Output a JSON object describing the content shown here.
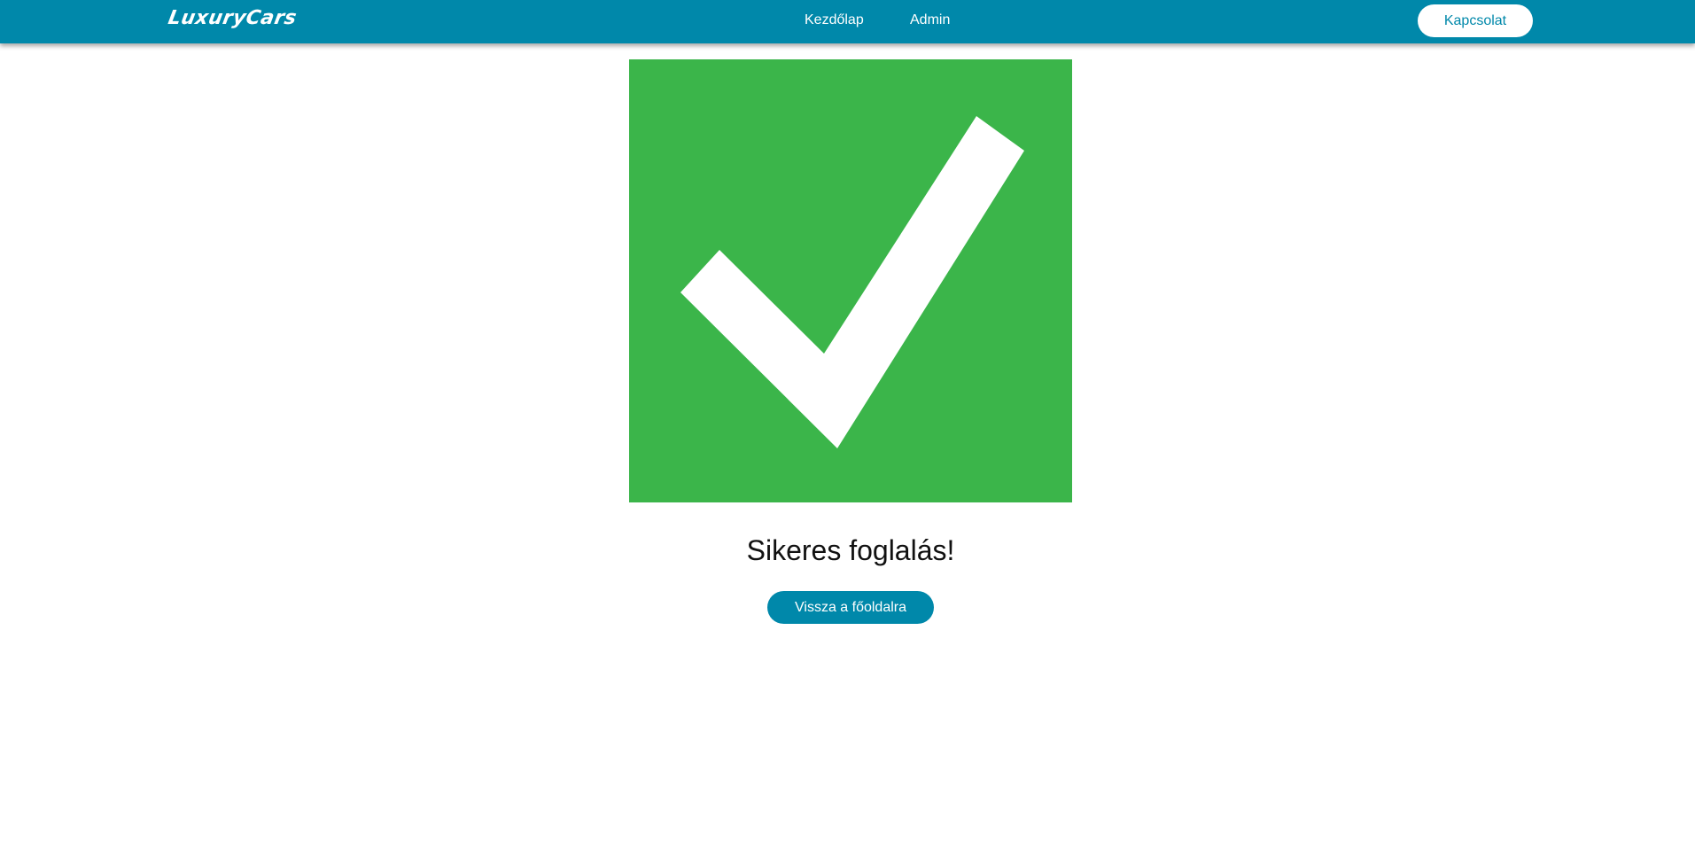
{
  "header": {
    "brand": "LuxuryCars",
    "nav": {
      "home": "Kezdőlap",
      "admin": "Admin"
    },
    "contact_label": "Kapcsolat"
  },
  "main": {
    "icon": "checkmark-icon",
    "title": "Sikeres foglalás!",
    "back_label": "Vissza a főoldalra"
  },
  "colors": {
    "primary": "#0088aa",
    "success": "#3bb54a",
    "background": "#ffffff"
  }
}
